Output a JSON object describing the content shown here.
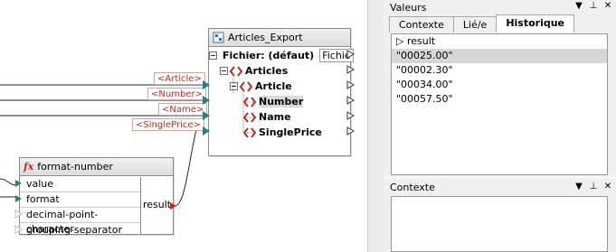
{
  "canvas": {
    "tags": {
      "article": "<Article>",
      "number": "<Number>",
      "name": "<Name>",
      "singleprice": "<SinglePrice>"
    },
    "export_component": {
      "title": "Articles_Export",
      "file_label": "Fichier: (défaut)",
      "file_button": "Fichie",
      "rows": {
        "articles": "Articles",
        "article": "Article",
        "number": "Number",
        "name": "Name",
        "singleprice": "SinglePrice"
      }
    },
    "function_box": {
      "title": "format-number",
      "inputs": {
        "value": "value",
        "format": "format",
        "decimal": "decimal-point-character",
        "grouping": "grouping-separator"
      },
      "output": "result"
    }
  },
  "values_pane": {
    "title": "Valeurs",
    "tabs": {
      "contexte": "Contexte",
      "liee": "Lié/e",
      "historique": "Historique"
    },
    "result_label": "result",
    "results": [
      "\"00025.00\"",
      "\"00002.30\"",
      "\"00034.00\"",
      "\"00057.50\""
    ]
  },
  "context_pane": {
    "title": "Contexte"
  },
  "colors": {
    "port": "#2f7f7f",
    "tag_text": "#b0302a",
    "element_icon": "#b0302a",
    "output_port": "#cc2020"
  }
}
